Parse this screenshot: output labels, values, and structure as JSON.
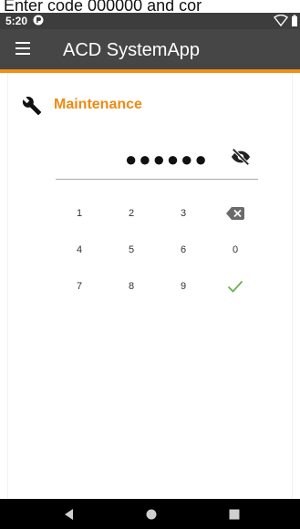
{
  "overlay": {
    "instruction": "Enter code 000000 and cor"
  },
  "status_bar": {
    "time": "5:20",
    "left_icon": "badge-icon",
    "right_icons": [
      "wifi-icon",
      "battery-icon"
    ]
  },
  "app_bar": {
    "title": "ACD SystemApp",
    "menu_icon": "menu-icon",
    "accent_color": "#f39015",
    "background": "#464646"
  },
  "section": {
    "title": "Maintenance",
    "icon": "wrench-icon",
    "title_color": "#ef8a12"
  },
  "pin": {
    "masked_value": "●●●●●●",
    "visibility_icon": "eye-off-icon"
  },
  "keypad": {
    "keys": [
      "1",
      "2",
      "3",
      "backspace",
      "4",
      "5",
      "6",
      "0",
      "7",
      "8",
      "9",
      "confirm"
    ],
    "confirm_color": "#6ab04c"
  },
  "nav_bar": {
    "buttons": [
      "back-icon",
      "home-icon",
      "recents-icon"
    ]
  }
}
